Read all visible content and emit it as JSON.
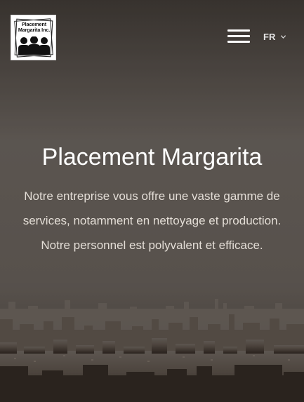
{
  "brand": {
    "logo_line1": "Placement",
    "logo_line2": "Margarita Inc."
  },
  "nav": {
    "menu_icon": "hamburger-menu-icon",
    "language": "FR",
    "language_icon": "chevron-down-icon"
  },
  "hero": {
    "title": "Placement Margarita",
    "description": "Notre entreprise vous offre une vaste gamme de services, notamment en nettoyage et production. Notre personnel est polyvalent et efficace."
  },
  "colors": {
    "text_primary": "#ffffff",
    "text_secondary": "#e3ddd6",
    "background_dark": "#3b3733"
  }
}
